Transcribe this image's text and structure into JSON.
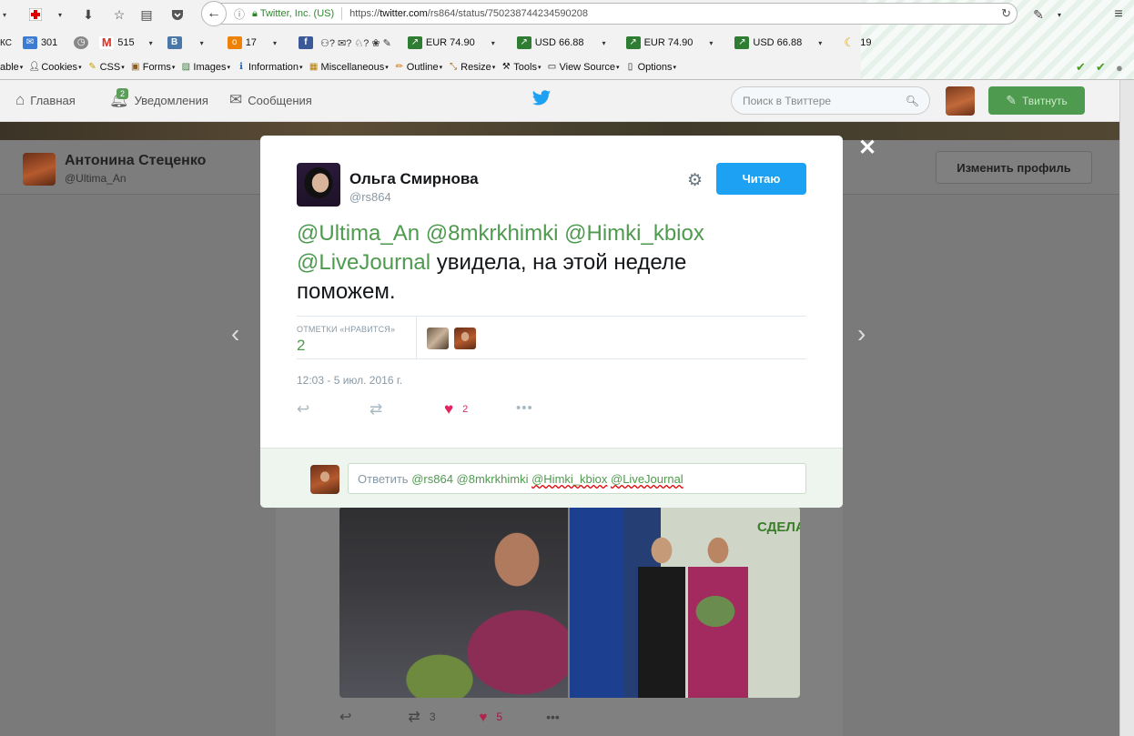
{
  "browser": {
    "url_site": "Twitter, Inc. (US)",
    "url_prefix": "https://",
    "url_domain": "twitter.com",
    "url_path": "/rs864/status/750238744234590208",
    "bookmarks": [
      {
        "icon": "mail-icon",
        "label": "301"
      },
      {
        "icon": "gmail-icon",
        "label": "515"
      },
      {
        "icon": "vk-icon",
        "label": ""
      },
      {
        "icon": "ok-icon",
        "label": "17"
      },
      {
        "icon": "chart-icon",
        "label": "EUR 74.90"
      },
      {
        "icon": "chart-icon",
        "label": "USD 66.88"
      },
      {
        "icon": "chart-icon",
        "label": "EUR 74.90"
      },
      {
        "icon": "chart-icon",
        "label": "USD 66.88"
      },
      {
        "icon": "weather-icon",
        "label": "19"
      }
    ],
    "webdev_menu": [
      {
        "icon": "cookie-icon",
        "label": "able"
      },
      {
        "icon": "user-icon",
        "label": "Cookies"
      },
      {
        "icon": "pencil-icon",
        "label": "CSS"
      },
      {
        "icon": "form-icon",
        "label": "Forms"
      },
      {
        "icon": "image-icon",
        "label": "Images"
      },
      {
        "icon": "info-icon",
        "label": "Information"
      },
      {
        "icon": "misc-icon",
        "label": "Miscellaneous"
      },
      {
        "icon": "outline-icon",
        "label": "Outline"
      },
      {
        "icon": "resize-icon",
        "label": "Resize"
      },
      {
        "icon": "tools-icon",
        "label": "Tools"
      },
      {
        "icon": "source-icon",
        "label": "View Source"
      },
      {
        "icon": "options-icon",
        "label": "Options"
      }
    ]
  },
  "nav": {
    "home": "Главная",
    "notifications": "Уведомления",
    "notifications_badge": "2",
    "messages": "Сообщения",
    "search_placeholder": "Поиск в Твиттере",
    "tweet_button": "Твитнуть"
  },
  "profile": {
    "name": "Антонина Стеценко",
    "handle": "@Ultima_An",
    "edit_button": "Изменить профиль"
  },
  "modal": {
    "author_name": "Ольга Смирнова",
    "author_handle": "@rs864",
    "follow_button": "Читаю",
    "text_mentions": [
      "@Ultima_An",
      "@8mkrkhimki",
      "@Himki_kbiox",
      "@LiveJournal"
    ],
    "text_body": "увидела, на этой неделе поможем.",
    "likes_label": "ОТМЕТКИ «НРАВИТСЯ»",
    "likes_count": "2",
    "date": "12:03 - 5 июл. 2016 г.",
    "like_action_count": "2",
    "reply_prefix": "Ответить",
    "reply_mentions": [
      "@rs864",
      "@8mkrkhimki",
      "@Himki_kbiox",
      "@LiveJournal"
    ]
  },
  "background_tweet": {
    "retweet_count": "3",
    "like_count": "5",
    "photo_sign": "СДЕЛАЕ"
  },
  "colors": {
    "accent_green": "#4e9a4e",
    "follow_blue": "#1da1f2",
    "like_red": "#e0245e"
  }
}
